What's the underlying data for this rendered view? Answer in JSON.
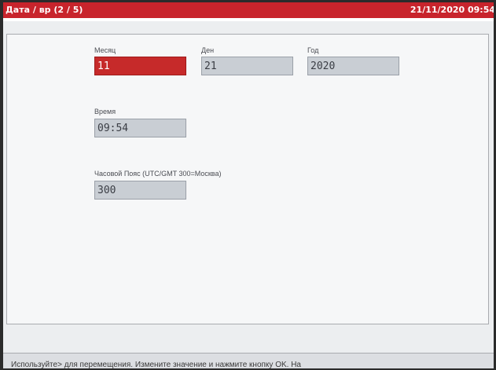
{
  "header": {
    "title": "Дата / вр (2 / 5)",
    "clock": "21/11/2020 09:54"
  },
  "fields": {
    "month": {
      "label": "Месяц",
      "value": "11"
    },
    "day": {
      "label": "Ден",
      "value": "21"
    },
    "year": {
      "label": "Год",
      "value": "2020"
    },
    "time": {
      "label": "Время",
      "value": "09:54"
    },
    "timezone": {
      "label": "Часовой Пояс (UTC/GMT 300=Москва)",
      "value": "300"
    }
  },
  "status_bar": {
    "text": "Используйте> для перемещения. Измените значение и нажмите кнопку OK. На"
  },
  "colors": {
    "accent": "#c8242c",
    "active_field": "#c62a2a",
    "field": "#c9ced4"
  }
}
